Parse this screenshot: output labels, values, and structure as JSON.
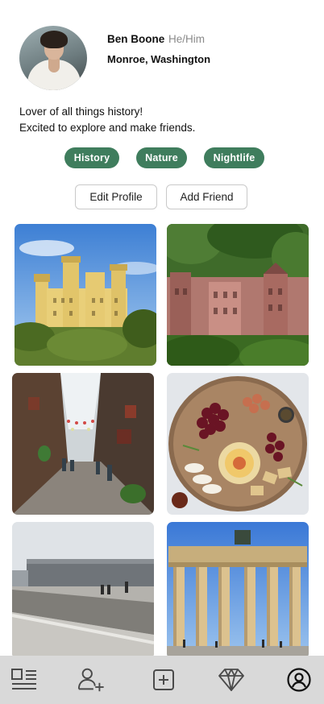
{
  "profile": {
    "name": "Ben Boone",
    "pronouns": "He/Him",
    "location": "Monroe, Washington",
    "bio_line1": "Lover of all things history!",
    "bio_line2": "Excited to explore and make friends."
  },
  "tags": [
    "History",
    "Nature",
    "Nightlife"
  ],
  "actions": {
    "edit_profile": "Edit Profile",
    "add_friend": "Add Friend"
  },
  "colors": {
    "tag_background": "#3f7d5d",
    "tab_bar": "#d9d9d9"
  },
  "photos": [
    {
      "subject": "castle-on-hill"
    },
    {
      "subject": "castle-ruins-forest"
    },
    {
      "subject": "village-street"
    },
    {
      "subject": "charcuterie-board"
    },
    {
      "subject": "modern-building"
    },
    {
      "subject": "brandenburg-gate"
    }
  ],
  "tab_bar": {
    "items": [
      "feed-icon",
      "friends-add-icon",
      "create-icon",
      "premium-diamond-icon",
      "profile-icon"
    ]
  }
}
